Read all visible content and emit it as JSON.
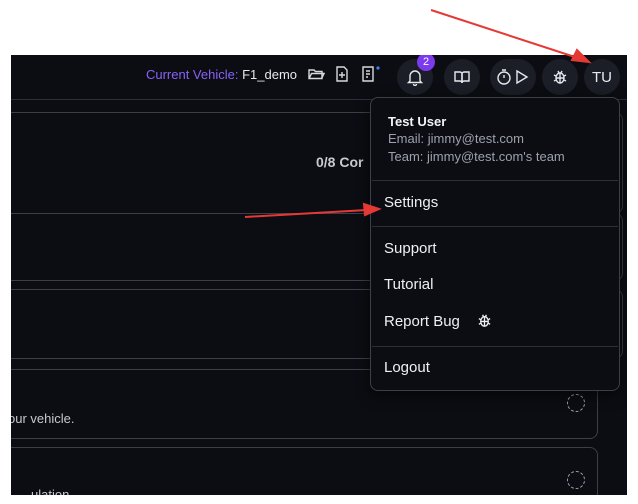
{
  "header": {
    "vehicle_label": "Current Vehicle:",
    "vehicle_name": "F1_demo",
    "notification_count": "2",
    "avatar_initials": "TU"
  },
  "main": {
    "progress_text": "0/8 Cor",
    "card_text_1": "our vehicle.",
    "card_text_2": "ulation"
  },
  "user_menu": {
    "name": "Test User",
    "email": "Email: jimmy@test.com",
    "team": "Team: jimmy@test.com's team",
    "items": {
      "settings": "Settings",
      "support": "Support",
      "tutorial": "Tutorial",
      "report_bug": "Report Bug",
      "logout": "Logout"
    }
  },
  "colors": {
    "accent": "#7c3aed",
    "annotation": "#e53935",
    "background": "#0b0d12"
  },
  "icons": [
    "folder-open-icon",
    "file-add-icon",
    "file-edit-icon",
    "bell-icon",
    "book-open-icon",
    "timer-icon",
    "play-icon",
    "bug-icon"
  ]
}
